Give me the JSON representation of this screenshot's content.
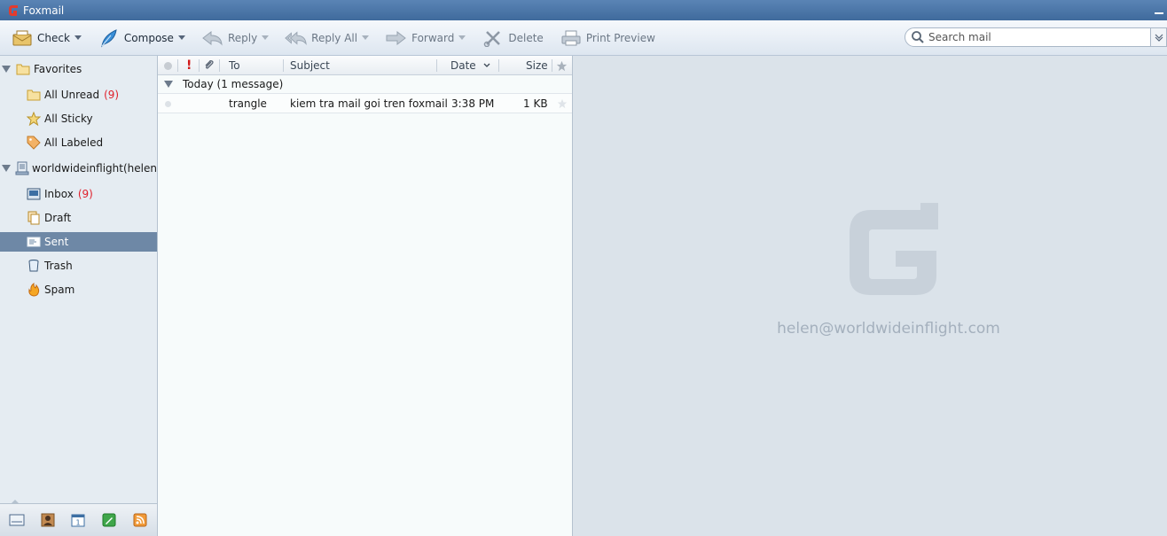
{
  "window": {
    "title": "Foxmail"
  },
  "toolbar": {
    "check_label": "Check",
    "compose_label": "Compose",
    "reply_label": "Reply",
    "reply_all_label": "Reply All",
    "forward_label": "Forward",
    "delete_label": "Delete",
    "print_preview_label": "Print Preview"
  },
  "search": {
    "placeholder": "Search mail",
    "value": ""
  },
  "sidebar": {
    "favorites": {
      "label": "Favorites",
      "items": [
        {
          "label": "All Unread",
          "count": "(9)"
        },
        {
          "label": "All Sticky"
        },
        {
          "label": "All Labeled"
        }
      ]
    },
    "account": {
      "label": "worldwideinflight(helen)",
      "folders": [
        {
          "label": "Inbox",
          "count": "(9)"
        },
        {
          "label": "Draft"
        },
        {
          "label": "Sent",
          "selected": true
        },
        {
          "label": "Trash"
        },
        {
          "label": "Spam"
        }
      ]
    },
    "bottom_icons": [
      "mail-icon",
      "contacts-icon",
      "calendar-icon",
      "notes-icon",
      "rss-icon"
    ]
  },
  "list": {
    "columns": {
      "to": "To",
      "subject": "Subject",
      "date": "Date",
      "size": "Size"
    },
    "group_label": "Today (1 message)",
    "messages": [
      {
        "to": "trangle",
        "subject": "kiem tra mail goi tren foxmail",
        "date": "3:38 PM",
        "size": "1 KB"
      }
    ]
  },
  "preview": {
    "account_email": "helen@worldwideinflight.com"
  },
  "colors": {
    "titlebar": "#4a76a8",
    "selected_row": "#6e88a6",
    "unread_count": "#e0202b",
    "important": "#d21a1a"
  }
}
